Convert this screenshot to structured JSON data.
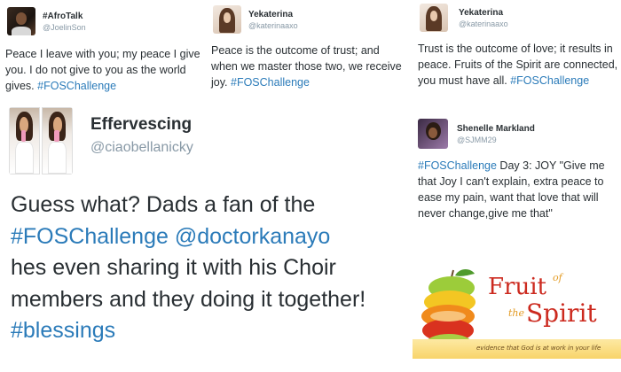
{
  "tweets": {
    "afrotalk": {
      "name": "#AfroTalk",
      "handle": "@JoelinSon",
      "text": "Peace I leave with you; my peace I give you. I do not give to you as the world gives. ",
      "tag": "#FOSChallenge"
    },
    "yekaterina1": {
      "name": "Yekaterina",
      "handle": "@katerinaaxo",
      "text": "Peace is the outcome of trust; and when we master those two, we receive joy. ",
      "tag": "#FOSChallenge"
    },
    "yekaterina2": {
      "name": "Yekaterina",
      "handle": "@katerinaaxo",
      "text": "Trust is the outcome of love; it results in peace. Fruits of the Spirit are connected, you must have all. ",
      "tag": "#FOSChallenge"
    },
    "effervescing": {
      "name": "Effervescing",
      "handle": "@ciaobellanicky",
      "text_1": "Guess what? Dads a fan of the",
      "tag_1": "#FOSChallenge",
      "mention": "@doctorkanayo",
      "text_2": "hes even sharing it with his Choir members and they doing it together! ",
      "tag_2": "#blessings"
    },
    "shenelle": {
      "name": "Shenelle Markland",
      "handle": "@SJMM29",
      "tag": "#FOSChallenge",
      "text": " Day 3: JOY \"Give me that Joy I can't explain, extra peace to ease my pain, want that love that will never change,give me that\""
    }
  },
  "logo": {
    "title_1": "Fruit",
    "of": "of",
    "the": "the",
    "title_2": "Spirit",
    "tagline": "evidence that God is at work in your life"
  },
  "colors": {
    "hashtag": "#2b7bb9",
    "handle": "#8899a6",
    "text": "#292f33",
    "logo_red": "#cc2a1f",
    "logo_orange": "#e39b24"
  }
}
